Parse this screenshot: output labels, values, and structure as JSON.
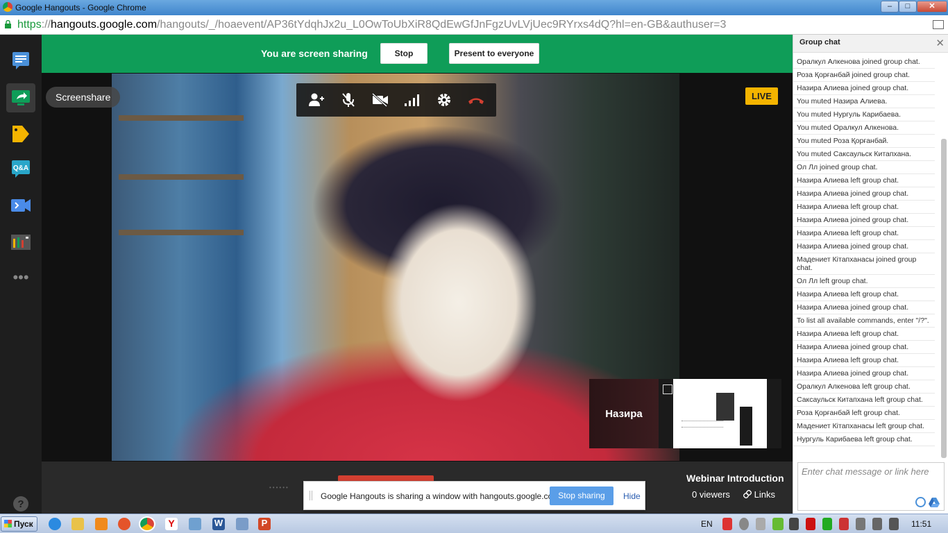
{
  "window": {
    "title": "Google Hangouts - Google Chrome",
    "controls": [
      "–",
      "□",
      "✕"
    ]
  },
  "address_bar": {
    "scheme": "https",
    "separator": "://",
    "host": "hangouts.google.com",
    "path": "/hangouts/_/hoaevent/AP36tYdqhJx2u_L0OwToUbXiR8QdEwGfJnFgzUvLVjUec9RYrxs4dQ?hl=en-GB&authuser=3"
  },
  "share_banner": {
    "message": "You are screen sharing",
    "stop_label": "Stop",
    "present_label": "Present to everyone"
  },
  "stage": {
    "screenshare_label": "Screenshare",
    "live_badge": "LIVE",
    "participant_name": "Назира",
    "webinar_title": "Webinar Introduction",
    "viewers": "0 viewers",
    "links_label": "Links"
  },
  "toolbar_icons": [
    "add-person-icon",
    "mic-muted-icon",
    "camera-off-icon",
    "signal-bars-icon",
    "settings-gear-icon",
    "hang-up-icon"
  ],
  "rail_icons": [
    "chat-icon",
    "screenshare-icon",
    "tag-icon",
    "qna-icon",
    "control-room-icon",
    "mixer-icon",
    "more-icon",
    "help-icon"
  ],
  "notification": {
    "text": "Google Hangouts is sharing a window with hangouts.google.com.",
    "stop_label": "Stop sharing",
    "hide_label": "Hide"
  },
  "chat": {
    "title": "Group chat",
    "close": "✕",
    "placeholder": "Enter chat message or link here",
    "messages": [
      "Оралкул Алкенова joined group chat.",
      "Роза Қорғанбай joined group chat.",
      "Назира Алиева joined group chat.",
      "You muted Назира Алиева.",
      "You muted Нургуль Карибаева.",
      "You muted Оралкул Алкенова.",
      "You muted Роза Қорғанбай.",
      "You muted Саксаульск Китапхана.",
      "Ол Лл joined group chat.",
      "Назира Алиева left group chat.",
      "Назира Алиева joined group chat.",
      "Назира Алиева left group chat.",
      "Назира Алиева joined group chat.",
      "Назира Алиева left group chat.",
      "Назира Алиева joined group chat.",
      "Мадениет Кітапханасы joined group chat.",
      "Ол Лл left group chat.",
      "Назира Алиева left group chat.",
      "Назира Алиева joined group chat.",
      "To list all available commands, enter \"/?\".",
      "Назира Алиева left group chat.",
      "Назира Алиева joined group chat.",
      "Назира Алиева left group chat.",
      "Назира Алиева joined group chat.",
      "Оралкул Алкенова left group chat.",
      "Саксаульск Китапхана left group chat.",
      "Роза Қорғанбай left group chat.",
      "Мадениет Кітапханасы left group chat.",
      "Нургуль Карибаева left group chat."
    ]
  },
  "taskbar": {
    "start_label": "Пуск",
    "language": "EN",
    "clock": "11:51"
  },
  "colors": {
    "share_green": "#0f9d58",
    "live_yellow": "#f4b400",
    "hangup_red": "#d23f31",
    "stop_sharing_blue": "#5a9ee8"
  }
}
